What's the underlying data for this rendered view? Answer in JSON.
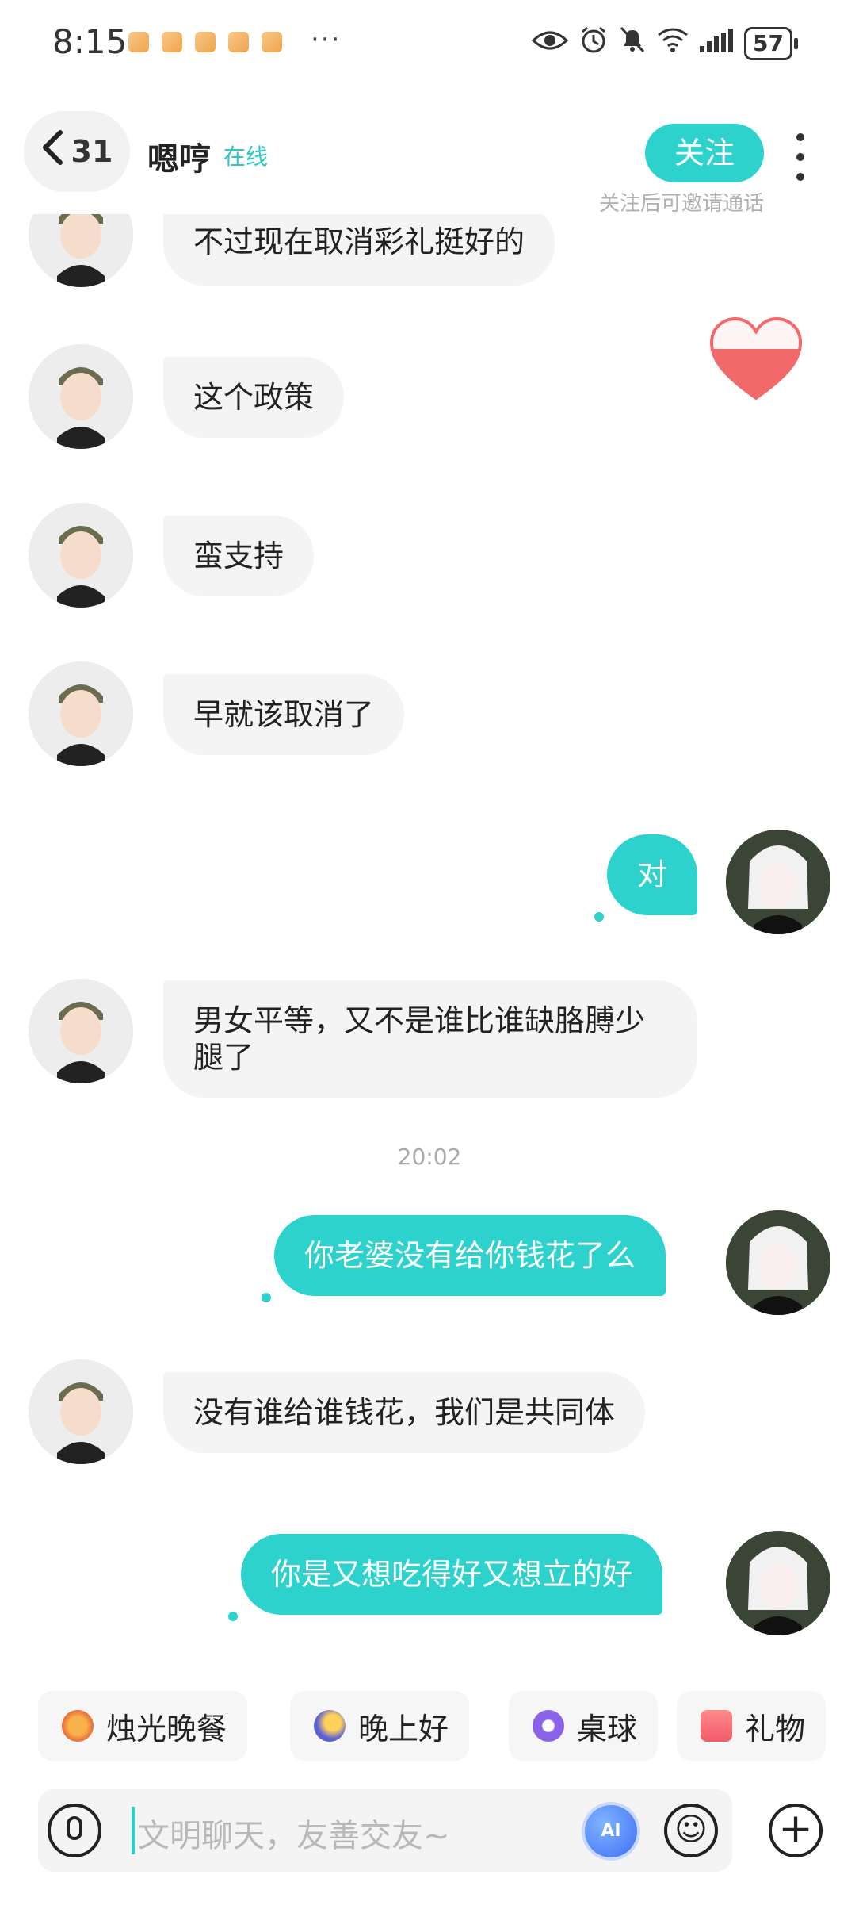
{
  "status_bar": {
    "time": "8:15",
    "more": "···",
    "battery": "57"
  },
  "header": {
    "back_count": "31",
    "contact_name": "嗯哼",
    "online_status": "在线",
    "follow_label": "关注",
    "follow_hint": "关注后可邀请通话"
  },
  "messages": [
    {
      "side": "left",
      "text": "不过现在取消彩礼挺好的"
    },
    {
      "side": "left",
      "text": "这个政策"
    },
    {
      "side": "left",
      "text": "蛮支持"
    },
    {
      "side": "left",
      "text": "早就该取消了"
    },
    {
      "side": "right",
      "text": "对"
    },
    {
      "side": "left",
      "text": "男女平等，又不是谁比谁缺胳膊少腿了"
    },
    {
      "side": "time",
      "text": "20:02"
    },
    {
      "side": "right",
      "text": "你老婆没有给你钱花了么"
    },
    {
      "side": "left",
      "text": "没有谁给谁钱花，我们是共同体"
    },
    {
      "side": "right",
      "text": "你是又想吃得好又想立的好"
    }
  ],
  "quick_chips": [
    {
      "label": "烛光晚餐",
      "icon": "candlelight-dinner-icon"
    },
    {
      "label": "晚上好",
      "icon": "moon-night-icon"
    },
    {
      "label": "桌球",
      "icon": "billiard-ball-icon"
    },
    {
      "label": "礼物",
      "icon": "gift-icon"
    }
  ],
  "input": {
    "placeholder": "文明聊天，友善交友~",
    "ai_label": "AI"
  },
  "colors": {
    "accent": "#2dd2cd",
    "bubble_in": "#f4f4f4",
    "heart": "#f2696c"
  }
}
